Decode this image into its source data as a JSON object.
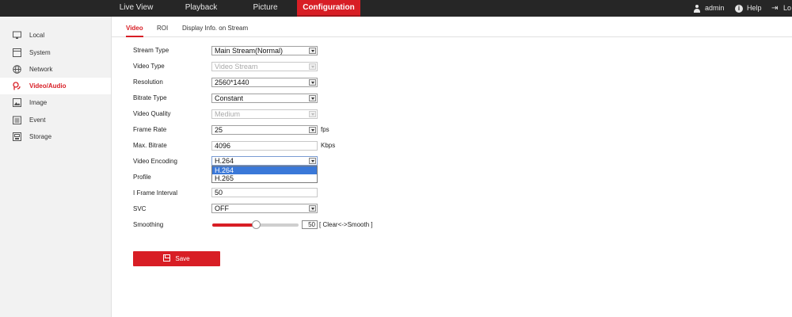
{
  "topnav": {
    "items": [
      {
        "label": "Live View",
        "active": false
      },
      {
        "label": "Playback",
        "active": false
      },
      {
        "label": "Picture",
        "active": false
      },
      {
        "label": "Configuration",
        "active": true
      }
    ],
    "user": "admin",
    "help": "Help",
    "logout": "Lo"
  },
  "sidebar": {
    "items": [
      {
        "label": "Local",
        "icon": "monitor-icon"
      },
      {
        "label": "System",
        "icon": "system-icon"
      },
      {
        "label": "Network",
        "icon": "globe-icon"
      },
      {
        "label": "Video/Audio",
        "icon": "video-audio-icon",
        "active": true
      },
      {
        "label": "Image",
        "icon": "image-icon"
      },
      {
        "label": "Event",
        "icon": "event-icon"
      },
      {
        "label": "Storage",
        "icon": "storage-icon"
      }
    ]
  },
  "tabs": [
    {
      "label": "Video",
      "active": true
    },
    {
      "label": "ROI"
    },
    {
      "label": "Display Info. on Stream"
    }
  ],
  "form": {
    "stream_type": {
      "label": "Stream Type",
      "value": "Main Stream(Normal)"
    },
    "video_type": {
      "label": "Video Type",
      "value": "Video Stream",
      "disabled": true
    },
    "resolution": {
      "label": "Resolution",
      "value": "2560*1440"
    },
    "bitrate_type": {
      "label": "Bitrate Type",
      "value": "Constant"
    },
    "video_quality": {
      "label": "Video Quality",
      "value": "Medium",
      "disabled": true
    },
    "frame_rate": {
      "label": "Frame Rate",
      "value": "25",
      "unit": "fps"
    },
    "max_bitrate": {
      "label": "Max. Bitrate",
      "value": "4096",
      "unit": "Kbps"
    },
    "video_encoding": {
      "label": "Video Encoding",
      "value": "H.264",
      "options": [
        "H.264",
        "H.265"
      ],
      "highlighted": "H.264"
    },
    "profile": {
      "label": "Profile"
    },
    "i_frame_interval": {
      "label": "I Frame Interval",
      "value": "50"
    },
    "svc": {
      "label": "SVC",
      "value": "OFF"
    },
    "smoothing": {
      "label": "Smoothing",
      "value": "50",
      "max": 100,
      "hint": "[ Clear<->Smooth ]"
    }
  },
  "save_label": "Save",
  "colors": {
    "accent": "#d81e25",
    "topbar": "#262626",
    "sidebar": "#f2f2f2",
    "selection": "#3a78d8"
  }
}
